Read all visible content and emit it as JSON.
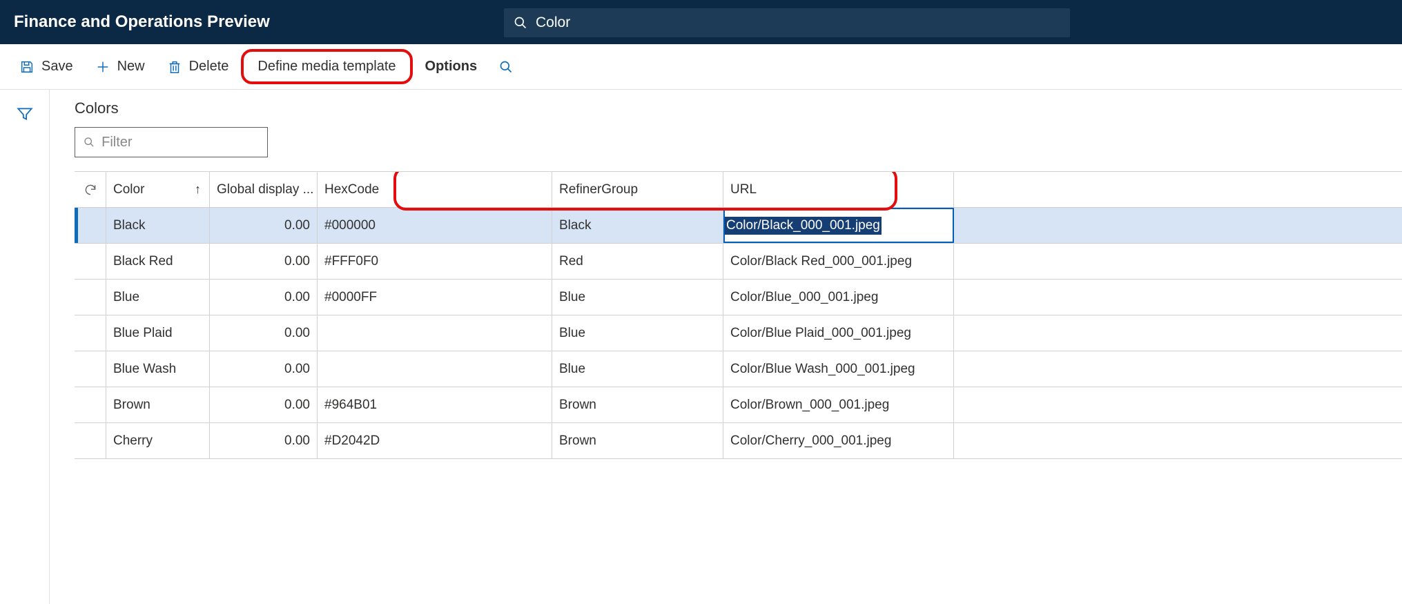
{
  "topbar": {
    "title": "Finance and Operations Preview",
    "search_value": "Color"
  },
  "actions": {
    "save": "Save",
    "new": "New",
    "delete": "Delete",
    "define_media_template": "Define media template",
    "options": "Options"
  },
  "page": {
    "heading": "Colors",
    "filter_placeholder": "Filter"
  },
  "grid": {
    "headers": {
      "color": "Color",
      "global_display": "Global display ...",
      "hexcode": "HexCode",
      "refiner": "RefinerGroup",
      "url": "URL"
    },
    "rows": [
      {
        "color": "Black",
        "display": "0.00",
        "hex": "#000000",
        "refiner": "Black",
        "url": "Color/Black_000_001.jpeg",
        "selected": true
      },
      {
        "color": "Black Red",
        "display": "0.00",
        "hex": "#FFF0F0",
        "refiner": "Red",
        "url": "Color/Black Red_000_001.jpeg"
      },
      {
        "color": "Blue",
        "display": "0.00",
        "hex": "#0000FF",
        "refiner": "Blue",
        "url": "Color/Blue_000_001.jpeg"
      },
      {
        "color": "Blue Plaid",
        "display": "0.00",
        "hex": "",
        "refiner": "Blue",
        "url": "Color/Blue Plaid_000_001.jpeg"
      },
      {
        "color": "Blue Wash",
        "display": "0.00",
        "hex": "",
        "refiner": "Blue",
        "url": "Color/Blue Wash_000_001.jpeg"
      },
      {
        "color": "Brown",
        "display": "0.00",
        "hex": "#964B01",
        "refiner": "Brown",
        "url": "Color/Brown_000_001.jpeg"
      },
      {
        "color": "Cherry",
        "display": "0.00",
        "hex": "#D2042D",
        "refiner": "Brown",
        "url": "Color/Cherry_000_001.jpeg"
      }
    ]
  }
}
